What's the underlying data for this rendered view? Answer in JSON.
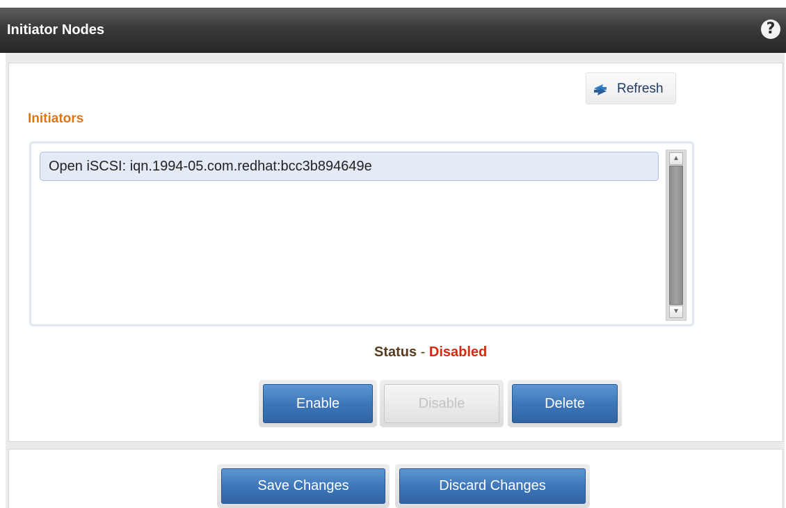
{
  "header": {
    "title": "Initiator Nodes",
    "help_label": "?"
  },
  "toolbar": {
    "refresh_label": "Refresh"
  },
  "initiators": {
    "label": "Initiators",
    "items": [
      "Open iSCSI: iqn.1994-05.com.redhat:bcc3b894649e"
    ]
  },
  "status": {
    "label": "Status",
    "separator": " - ",
    "value": "Disabled",
    "value_color": "#d22b10"
  },
  "actions": {
    "enable_label": "Enable",
    "disable_label": "Disable",
    "delete_label": "Delete"
  },
  "footer": {
    "save_label": "Save Changes",
    "discard_label": "Discard Changes"
  },
  "colors": {
    "accent_orange": "#e07514",
    "button_blue": "#3c74b7",
    "header_dark": "#3a3a3a"
  }
}
